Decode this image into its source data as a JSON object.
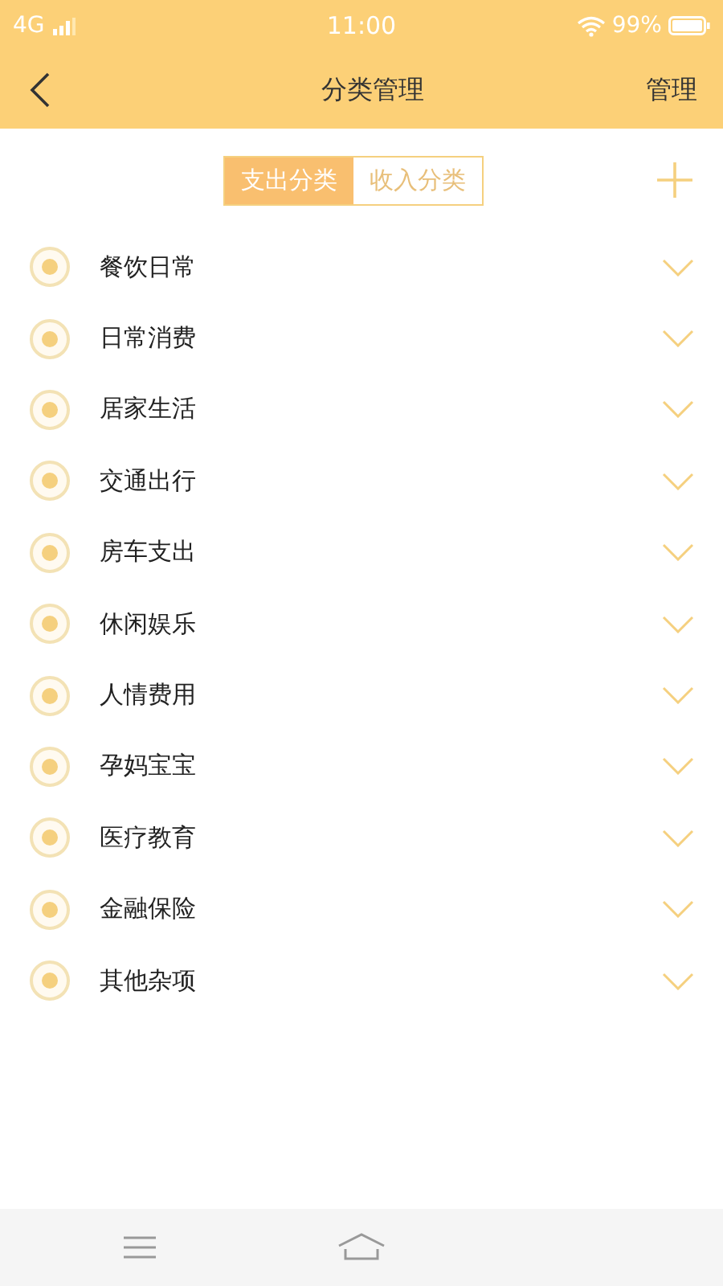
{
  "status_bar": {
    "network": "4G",
    "time": "11:00",
    "battery": "99%"
  },
  "header": {
    "title": "分类管理",
    "action": "管理"
  },
  "tabs": [
    {
      "label": "支出分类",
      "selected": true
    },
    {
      "label": "收入分类",
      "selected": false
    }
  ],
  "categories": [
    {
      "name": "餐饮日常"
    },
    {
      "name": "日常消费"
    },
    {
      "name": "居家生活"
    },
    {
      "name": "交通出行"
    },
    {
      "name": "房车支出"
    },
    {
      "name": "休闲娱乐"
    },
    {
      "name": "人情费用"
    },
    {
      "name": "孕妈宝宝"
    },
    {
      "name": "医疗教育"
    },
    {
      "name": "金融保险"
    },
    {
      "name": "其他杂项"
    }
  ]
}
